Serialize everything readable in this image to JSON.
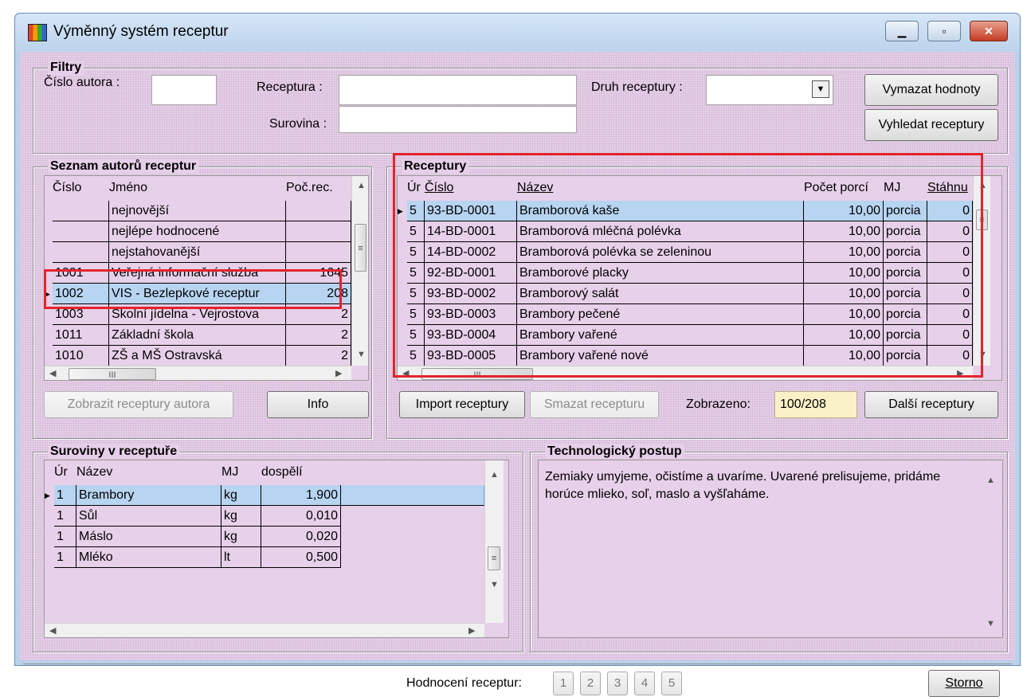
{
  "window": {
    "title": "Výměnný systém receptur"
  },
  "filters": {
    "legend": "Filtry",
    "author_no_label": "Číslo autora :",
    "recipe_label": "Receptura :",
    "ingredient_label": "Surovina :",
    "recipe_type_label": "Druh receptury :",
    "clear_button": "Vymazat hodnoty",
    "search_button": "Vyhledat receptury"
  },
  "authors": {
    "legend": "Seznam autorů receptur",
    "columns": [
      "Číslo",
      "Jméno",
      "Poč.rec."
    ],
    "rows": [
      {
        "no": "",
        "name": "nejnovější",
        "count": ""
      },
      {
        "no": "",
        "name": "nejlépe hodnocené",
        "count": ""
      },
      {
        "no": "",
        "name": "nejstahovanější",
        "count": ""
      },
      {
        "no": "1001",
        "name": "Veřejná informační služba",
        "count": "1645"
      },
      {
        "no": "1002",
        "name": "VIS - Bezlepkové receptur",
        "count": "208"
      },
      {
        "no": "1003",
        "name": "Školní jídelna - Vejrostova",
        "count": "2"
      },
      {
        "no": "1011",
        "name": "Základní škola",
        "count": "2"
      },
      {
        "no": "1010",
        "name": "ZŠ a MŠ Ostravská",
        "count": "2"
      }
    ],
    "show_button": "Zobrazit receptury autora",
    "info_button": "Info"
  },
  "recipes": {
    "legend": "Receptury",
    "columns": [
      "Úr",
      "Číslo",
      "Název",
      "Počet porcí",
      "MJ",
      "Stáhnu"
    ],
    "rows": [
      {
        "level": "5",
        "no": "93-BD-0001",
        "name": "Bramborová kaše",
        "portions": "10,00",
        "unit": "porcia",
        "dl": "0"
      },
      {
        "level": "5",
        "no": "14-BD-0001",
        "name": "Bramborová mléčná polévka",
        "portions": "10,00",
        "unit": "porcia",
        "dl": "0"
      },
      {
        "level": "5",
        "no": "14-BD-0002",
        "name": "Bramborová polévka se zeleninou",
        "portions": "10,00",
        "unit": "porcia",
        "dl": "0"
      },
      {
        "level": "5",
        "no": "92-BD-0001",
        "name": "Bramborové placky",
        "portions": "10,00",
        "unit": "porcia",
        "dl": "0"
      },
      {
        "level": "5",
        "no": "93-BD-0002",
        "name": "Bramborový salát",
        "portions": "10,00",
        "unit": "porcia",
        "dl": "0"
      },
      {
        "level": "5",
        "no": "93-BD-0003",
        "name": "Brambory pečené",
        "portions": "10,00",
        "unit": "porcia",
        "dl": "0"
      },
      {
        "level": "5",
        "no": "93-BD-0004",
        "name": "Brambory vařené",
        "portions": "10,00",
        "unit": "porcia",
        "dl": "0"
      },
      {
        "level": "5",
        "no": "93-BD-0005",
        "name": "Brambory vařené nové",
        "portions": "10,00",
        "unit": "porcia",
        "dl": "0"
      }
    ],
    "import_button": "Import receptury",
    "delete_button": "Smazat recepturu",
    "shown_label": "Zobrazeno:",
    "shown_value": "100/208",
    "more_button": "Další receptury"
  },
  "ingredients": {
    "legend": "Suroviny v receptuře",
    "columns": [
      "Úr",
      "Název",
      "MJ",
      "dospělí"
    ],
    "rows": [
      {
        "level": "1",
        "name": "Brambory",
        "unit": "kg",
        "qty": "1,900"
      },
      {
        "level": "1",
        "name": "Sůl",
        "unit": "kg",
        "qty": "0,010"
      },
      {
        "level": "1",
        "name": "Máslo",
        "unit": "kg",
        "qty": "0,020"
      },
      {
        "level": "1",
        "name": "Mléko",
        "unit": "lt",
        "qty": "0,500"
      }
    ]
  },
  "technology": {
    "legend": "Technologický postup",
    "text": "Zemiaky umyjeme, očistíme a uvaríme. Uvarené prelisujeme, pridáme horúce mlieko, soľ, maslo a vyšľaháme."
  },
  "footer": {
    "rating_label": "Hodnocení receptur:",
    "ratings": [
      "1",
      "2",
      "3",
      "4",
      "5"
    ],
    "cancel_button": "Storno"
  },
  "colors": {
    "highlight_red": "#e3242b",
    "selection": "#b7d4f1",
    "background": "#e6cfe8"
  }
}
